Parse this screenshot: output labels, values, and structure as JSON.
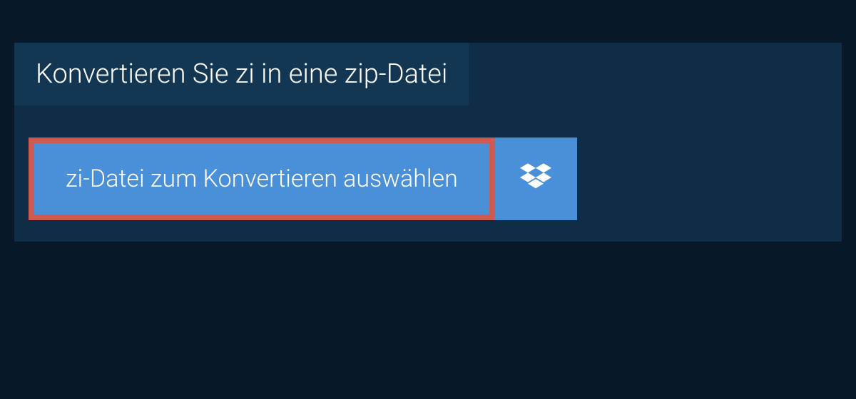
{
  "header": {
    "title": "Konvertieren Sie zi in eine zip-Datei"
  },
  "actions": {
    "select_file_label": "zi-Datei zum Konvertieren auswählen",
    "dropbox_icon": "dropbox"
  },
  "colors": {
    "page_bg": "#081828",
    "panel_bg": "#0f2d46",
    "title_bg": "#133753",
    "button_bg": "#4a90d9",
    "highlight_border": "#cf5a52"
  }
}
